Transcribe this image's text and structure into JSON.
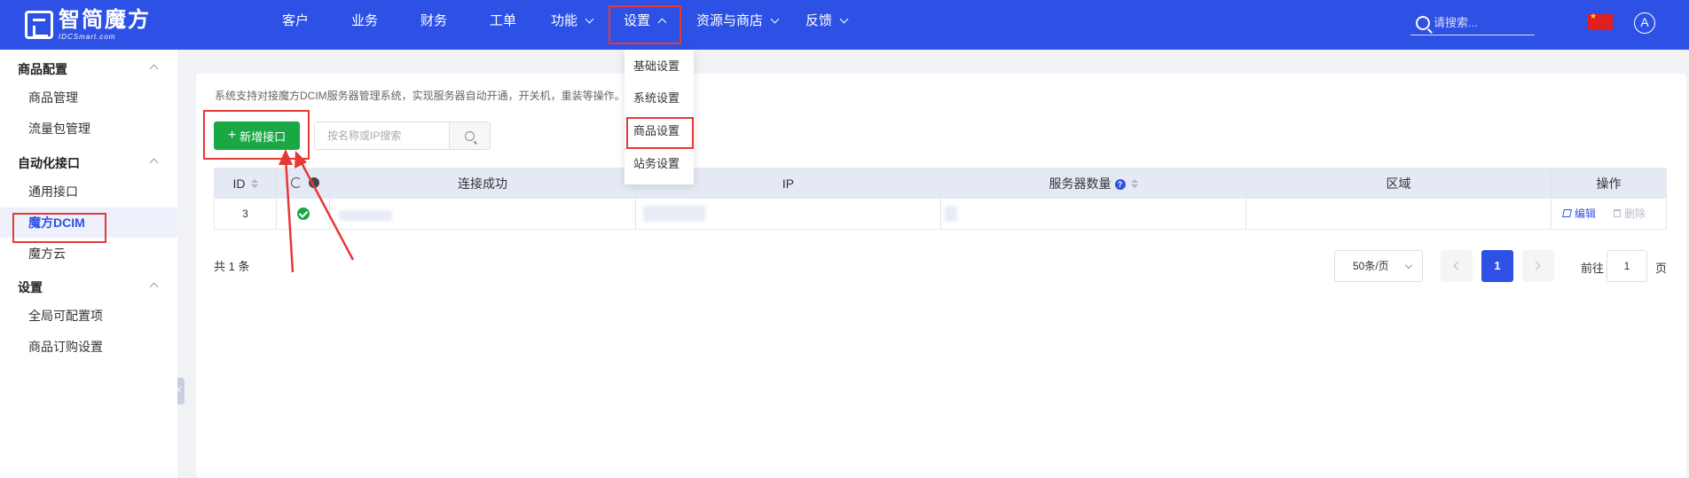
{
  "app": {
    "logo_cn": "智简魔方",
    "logo_en": "IDCSmart.com"
  },
  "nav": {
    "items": [
      {
        "label": "客户"
      },
      {
        "label": "业务"
      },
      {
        "label": "财务"
      },
      {
        "label": "工单"
      },
      {
        "label": "功能"
      },
      {
        "label": "设置"
      },
      {
        "label": "资源与商店"
      },
      {
        "label": "反馈"
      }
    ],
    "search_placeholder": "请搜索...",
    "avatar_letter": "A"
  },
  "settings_menu": {
    "items": [
      {
        "label": "基础设置"
      },
      {
        "label": "系统设置"
      },
      {
        "label": "商品设置"
      },
      {
        "label": "站务设置"
      }
    ]
  },
  "sidebar": {
    "groups": [
      {
        "label": "商品配置",
        "items": [
          {
            "label": "商品管理"
          },
          {
            "label": "流量包管理"
          }
        ]
      },
      {
        "label": "自动化接口",
        "items": [
          {
            "label": "通用接口"
          },
          {
            "label": "魔方DCIM"
          },
          {
            "label": "魔方云"
          }
        ]
      },
      {
        "label": "设置",
        "items": [
          {
            "label": "全局可配置项"
          },
          {
            "label": "商品订购设置"
          }
        ]
      }
    ],
    "active_item": "魔方DCIM"
  },
  "main": {
    "description": "系统支持对接魔方DCIM服务器管理系统，实现服务器自动开通，开关机，重装等操作。",
    "add_button": "新增接口",
    "search_placeholder": "按名称或IP搜索",
    "table": {
      "columns": [
        "ID",
        "连接成功",
        "IP",
        "服务器数量",
        "区域",
        "操作"
      ],
      "rows": [
        {
          "id": "3",
          "edit": "编辑",
          "delete": "删除"
        }
      ]
    },
    "total": "共 1 条",
    "pagination": {
      "page_size": "50条/页",
      "current_page": "1",
      "goto_label": "前往",
      "goto_value": "1",
      "goto_suffix": "页"
    }
  },
  "colors": {
    "primary": "#2e51e5",
    "success": "#19a844",
    "annotation": "#e53935"
  }
}
